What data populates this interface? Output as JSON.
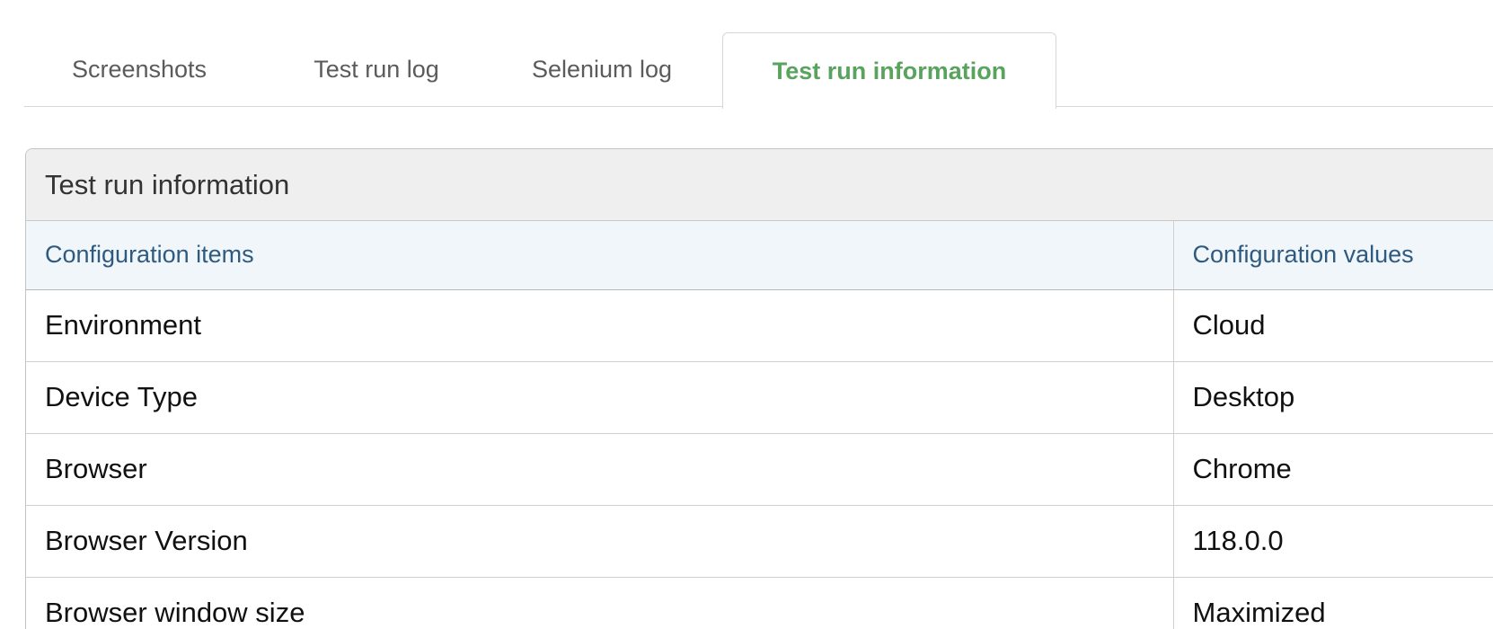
{
  "tabs": [
    {
      "label": "Screenshots",
      "active": false
    },
    {
      "label": "Test run log",
      "active": false
    },
    {
      "label": "Selenium log",
      "active": false
    },
    {
      "label": "Test run information",
      "active": true
    }
  ],
  "colors": {
    "active_tab": "#5aa35f",
    "header_text": "#2f5a80",
    "header_bg": "#f1f6fb",
    "panel_heading_bg": "#efefef"
  },
  "panel": {
    "title": "Test run information",
    "table": {
      "headers": [
        "Configuration items",
        "Configuration values"
      ],
      "rows": [
        {
          "item": "Environment",
          "value": "Cloud"
        },
        {
          "item": "Device Type",
          "value": "Desktop"
        },
        {
          "item": "Browser",
          "value": "Chrome"
        },
        {
          "item": "Browser Version",
          "value": "118.0.0"
        },
        {
          "item": "Browser window size",
          "value": "Maximized"
        }
      ]
    }
  }
}
